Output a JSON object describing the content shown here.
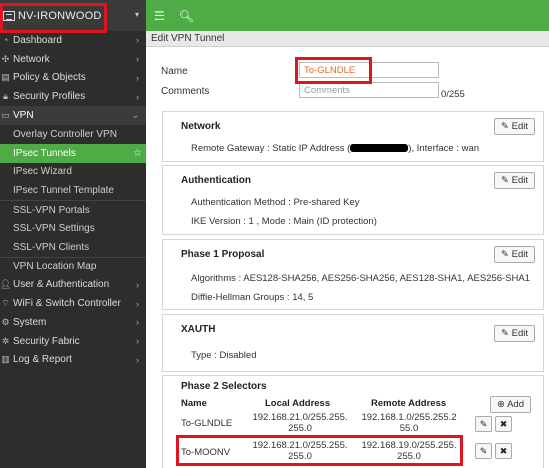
{
  "sidebar": {
    "device_name": "NV-IRONWOOD",
    "items": [
      {
        "label": "Dashboard"
      },
      {
        "label": "Network"
      },
      {
        "label": "Policy & Objects"
      },
      {
        "label": "Security Profiles"
      },
      {
        "label": "VPN"
      },
      {
        "label": "Overlay Controller VPN"
      },
      {
        "label": "IPsec Tunnels"
      },
      {
        "label": "IPsec Wizard"
      },
      {
        "label": "IPsec Tunnel Template"
      },
      {
        "label": "SSL-VPN Portals"
      },
      {
        "label": "SSL-VPN Settings"
      },
      {
        "label": "SSL-VPN Clients"
      },
      {
        "label": "VPN Location Map"
      },
      {
        "label": "User & Authentication"
      },
      {
        "label": "WiFi & Switch Controller"
      },
      {
        "label": "System"
      },
      {
        "label": "Security Fabric"
      },
      {
        "label": "Log & Report"
      }
    ]
  },
  "header": {
    "breadcrumb": "Edit VPN Tunnel"
  },
  "form": {
    "name_label": "Name",
    "name_value": "To-GLNDLE",
    "comments_label": "Comments",
    "comments_placeholder": "Comments",
    "comments_count": "0/255"
  },
  "network": {
    "title": "Network",
    "gateway_prefix": "Remote Gateway : Static IP Address (",
    "gateway_suffix": "), Interface : wan",
    "edit_label": "Edit"
  },
  "authentication": {
    "title": "Authentication",
    "method": "Authentication Method : Pre-shared Key",
    "ike": "IKE Version : 1 , Mode : Main (ID protection)",
    "edit_label": "Edit"
  },
  "phase1": {
    "title": "Phase 1 Proposal",
    "algorithms": "Algorithms : AES128-SHA256, AES256-SHA256, AES128-SHA1, AES256-SHA1",
    "dh": "Diffie-Hellman Groups : 14, 5",
    "edit_label": "Edit"
  },
  "xauth": {
    "title": "XAUTH",
    "type": "Type : Disabled",
    "edit_label": "Edit"
  },
  "phase2": {
    "title": "Phase 2 Selectors",
    "headers": {
      "name": "Name",
      "local": "Local Address",
      "remote": "Remote Address"
    },
    "add_label": "Add",
    "rows": [
      {
        "name": "To-GLNDLE",
        "local_1": "192.168.21.0/255.255.",
        "local_2": "255.0",
        "remote_1": "192.168.1.0/255.255.2",
        "remote_2": "55.0"
      },
      {
        "name": "To-MOONV",
        "local_1": "192.168.21.0/255.255.",
        "local_2": "255.0",
        "remote_1": "192.168.19.0/255.255.",
        "remote_2": "255.0"
      }
    ]
  }
}
